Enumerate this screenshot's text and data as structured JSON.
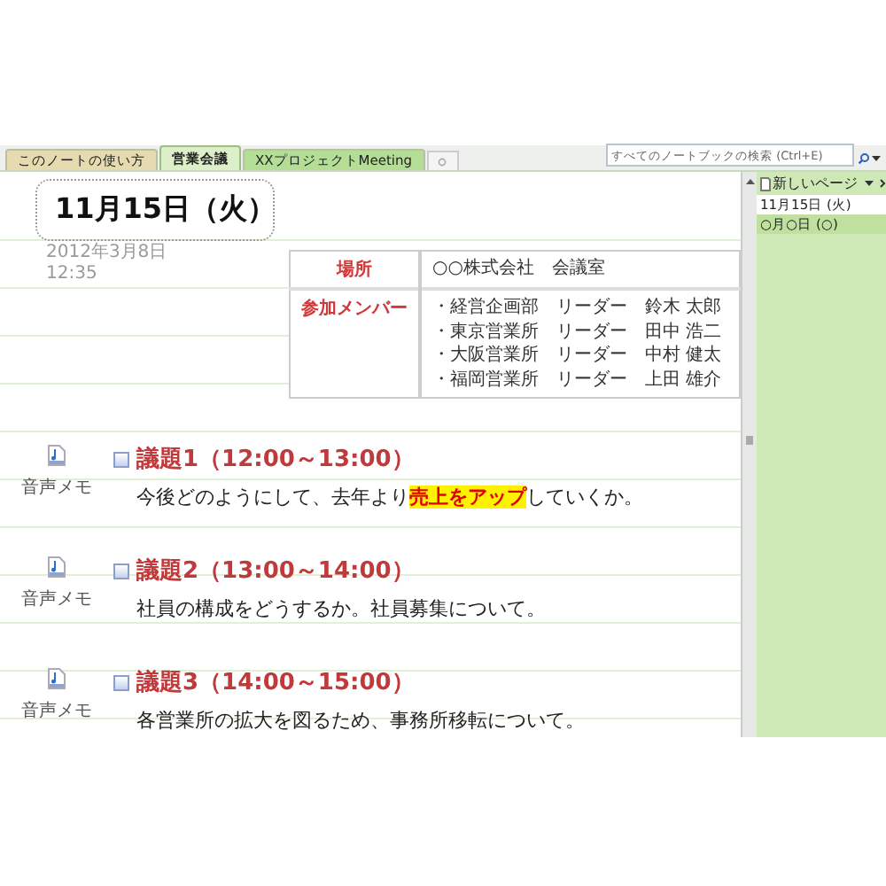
{
  "tabs": [
    {
      "label": "このノートの使い方",
      "selected": false,
      "color": "#e6dbb0"
    },
    {
      "label": "営業会議",
      "selected": true,
      "color": "#dcefc8"
    },
    {
      "label": "XXプロジェクトMeeting",
      "selected": false,
      "color": "#b4de96"
    }
  ],
  "search": {
    "placeholder": "すべてのノートブックの検索 (Ctrl+E)"
  },
  "page": {
    "title": "11月15日（火）",
    "date": "2012年3月8日",
    "time": "12:35",
    "info_table": {
      "rows": [
        {
          "label": "場所",
          "values": [
            "○○株式会社　会議室"
          ]
        },
        {
          "label": "参加メンバー",
          "values": [
            "・経営企画部　リーダー　鈴木 太郎",
            "・東京営業所　リーダー　田中 浩二",
            "・大阪営業所　リーダー　中村 健太",
            "・福岡営業所　リーダー　上田 雄介"
          ]
        }
      ]
    },
    "agenda": [
      {
        "audio_label": "音声メモ",
        "heading": "議題1（12:00～13:00）",
        "checked": false,
        "text": "今後どのようにして、去年より**売上をアップ**していくか。"
      },
      {
        "audio_label": "音声メモ",
        "heading": "議題2（13:00～14:00）",
        "checked": false,
        "text": "社員の構成をどうするか。社員募集について。"
      },
      {
        "audio_label": "音声メモ",
        "heading": "議題3（14:00～15:00）",
        "checked": false,
        "text": "各営業所の拡大を図るため、事務所移転について。"
      }
    ]
  },
  "sidebar": {
    "new_page": "新しいページ",
    "pages": [
      {
        "label": "11月15日 (火)",
        "selected": true
      },
      {
        "label": "○月○日 (○)",
        "selected": false
      }
    ]
  }
}
